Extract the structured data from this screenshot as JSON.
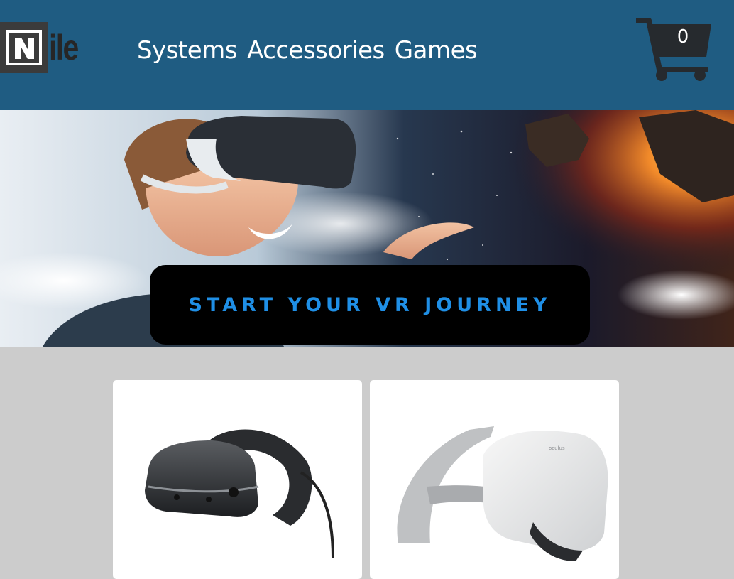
{
  "brand": {
    "logo_mark": "N",
    "logo_rest": "ile"
  },
  "nav": {
    "items": [
      {
        "label": "Systems"
      },
      {
        "label": "Accessories"
      },
      {
        "label": "Games"
      }
    ]
  },
  "cart": {
    "count": "0",
    "icon": "shopping-cart-icon"
  },
  "hero": {
    "cta_label": "START YOUR VR JOURNEY"
  },
  "products": {
    "items": [
      {
        "image": "vr-headset-black-image"
      },
      {
        "image": "vr-headset-white-image"
      }
    ]
  },
  "colors": {
    "header_bg": "#1f5c82",
    "page_bg": "#cccccc",
    "cta_text": "#1f8fe6",
    "cart_icon": "#262a2e"
  }
}
